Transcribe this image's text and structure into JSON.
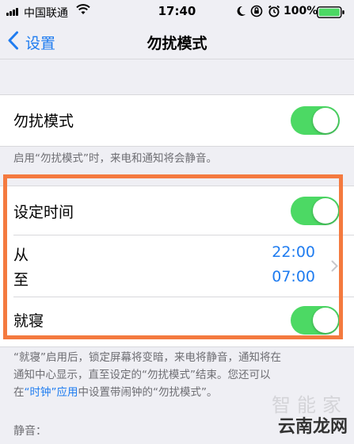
{
  "status_bar": {
    "carrier": "中国联通",
    "time": "17:40",
    "battery_percent": "100%",
    "icons": [
      "signal-bars-icon",
      "wifi-icon",
      "moon-icon",
      "rotation-lock-icon",
      "alarm-icon",
      "battery-icon"
    ]
  },
  "nav": {
    "back_label": "设置",
    "title": "勿扰模式"
  },
  "dnd": {
    "label": "勿扰模式",
    "toggle_on": true,
    "footnote": "启用“勿扰模式”时，来电和通知将会静音。"
  },
  "schedule": {
    "label": "设定时间",
    "toggle_on": true,
    "from_label": "从",
    "to_label": "至",
    "from_time": "22:00",
    "to_time": "07:00"
  },
  "bedtime": {
    "label": "就寝",
    "toggle_on": true,
    "footnote_line1": "“就寝”启用后，锁定屏幕将变暗，来电将静音，通知将在",
    "footnote_line2": "通知中心显示，直至设定的“勿扰模式”结束。您还可以",
    "footnote_line3_prefix": "在",
    "footnote_link": "“时钟”应用",
    "footnote_line3_suffix": "中设置带闹钟的“勿扰模式”。"
  },
  "silence_section": {
    "header": "静音："
  },
  "watermark": {
    "top_text": "智能家",
    "bottom_text": "云南龙网"
  },
  "colors": {
    "accent": "#1f7cf0",
    "toggle_on": "#4cd964",
    "highlight": "#f47a3f",
    "background": "#efeff4"
  }
}
